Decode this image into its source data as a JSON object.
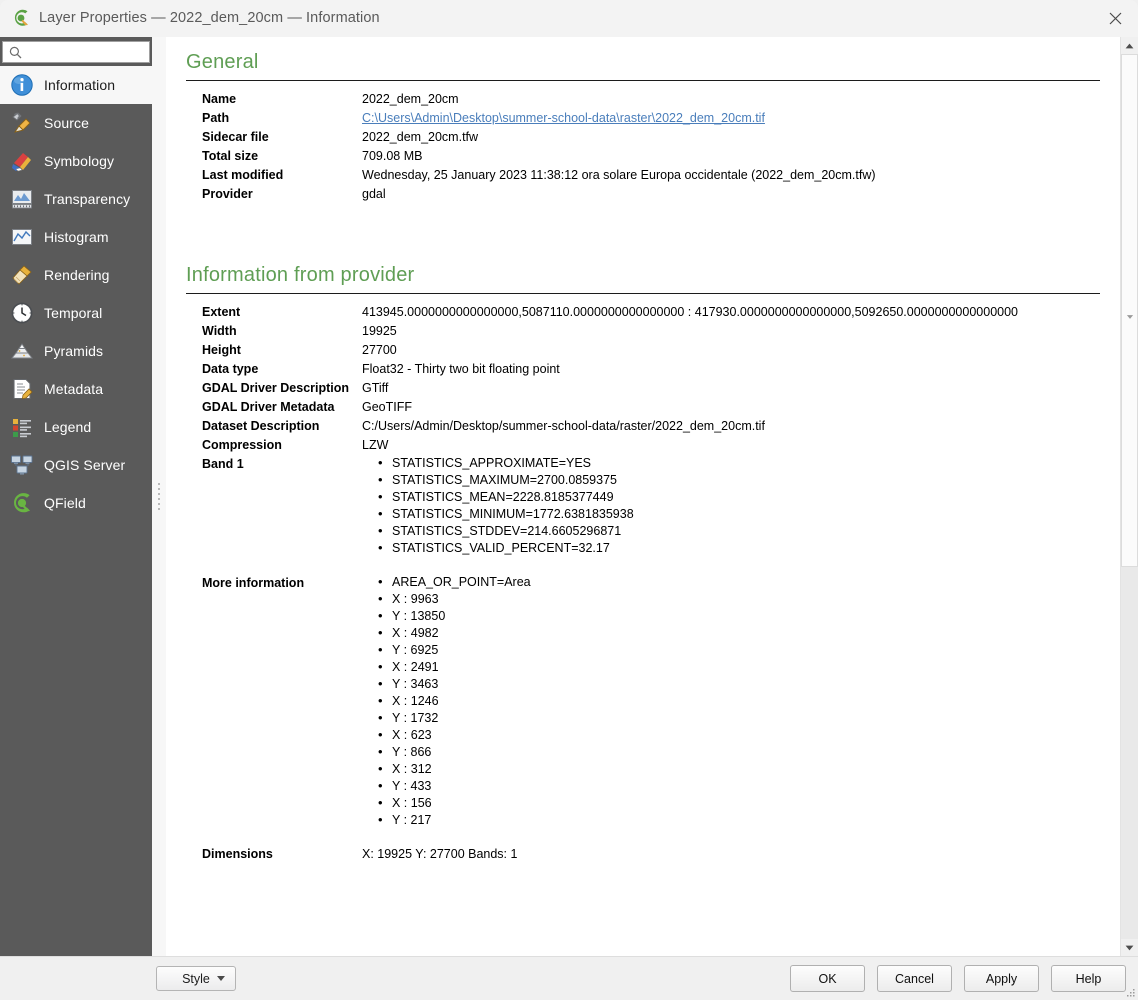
{
  "window": {
    "title": "Layer Properties — 2022_dem_20cm — Information",
    "logo_icon": "qgis-logo-icon",
    "close_icon": "close-icon"
  },
  "sidebar": {
    "search": {
      "value": "",
      "placeholder": "",
      "icon": "search-icon"
    },
    "items": [
      {
        "label": "Information",
        "icon": "information-icon",
        "selected": true
      },
      {
        "label": "Source",
        "icon": "source-icon",
        "selected": false
      },
      {
        "label": "Symbology",
        "icon": "symbology-icon",
        "selected": false
      },
      {
        "label": "Transparency",
        "icon": "transparency-icon",
        "selected": false
      },
      {
        "label": "Histogram",
        "icon": "histogram-icon",
        "selected": false
      },
      {
        "label": "Rendering",
        "icon": "rendering-icon",
        "selected": false
      },
      {
        "label": "Temporal",
        "icon": "temporal-clock-icon",
        "selected": false
      },
      {
        "label": "Pyramids",
        "icon": "pyramids-icon",
        "selected": false
      },
      {
        "label": "Metadata",
        "icon": "metadata-icon",
        "selected": false
      },
      {
        "label": "Legend",
        "icon": "legend-icon",
        "selected": false
      },
      {
        "label": "QGIS Server",
        "icon": "qgis-server-icon",
        "selected": false
      },
      {
        "label": "QField",
        "icon": "qfield-icon",
        "selected": false
      }
    ]
  },
  "content": {
    "general": {
      "title": "General",
      "rows": [
        {
          "key": "Name",
          "value": "2022_dem_20cm",
          "link": false
        },
        {
          "key": "Path",
          "value": "C:\\Users\\Admin\\Desktop\\summer-school-data\\raster\\2022_dem_20cm.tif",
          "link": true
        },
        {
          "key": "Sidecar file",
          "value": "2022_dem_20cm.tfw",
          "link": false
        },
        {
          "key": "Total size",
          "value": "709.08 MB",
          "link": false
        },
        {
          "key": "Last modified",
          "value": "Wednesday, 25 January 2023 11:38:12 ora solare Europa occidentale (2022_dem_20cm.tfw)",
          "link": false
        },
        {
          "key": "Provider",
          "value": "gdal",
          "link": false
        }
      ]
    },
    "provider": {
      "title": "Information from provider",
      "rows": [
        {
          "key": "Extent",
          "value": "413945.0000000000000000,5087110.0000000000000000 : 417930.0000000000000000,5092650.0000000000000000"
        },
        {
          "key": "Width",
          "value": "19925"
        },
        {
          "key": "Height",
          "value": "27700"
        },
        {
          "key": "Data type",
          "value": "Float32 - Thirty two bit floating point"
        },
        {
          "key": "GDAL Driver Description",
          "value": "GTiff"
        },
        {
          "key": "GDAL Driver Metadata",
          "value": "GeoTIFF"
        },
        {
          "key": "Dataset Description",
          "value": "C:/Users/Admin/Desktop/summer-school-data/raster/2022_dem_20cm.tif"
        },
        {
          "key": "Compression",
          "value": "LZW"
        }
      ],
      "band1": {
        "key": "Band 1",
        "stats": [
          "STATISTICS_APPROXIMATE=YES",
          "STATISTICS_MAXIMUM=2700.0859375",
          "STATISTICS_MEAN=2228.8185377449",
          "STATISTICS_MINIMUM=1772.6381835938",
          "STATISTICS_STDDEV=214.6605296871",
          "STATISTICS_VALID_PERCENT=32.17"
        ]
      },
      "more_information": {
        "key": "More information",
        "area_or_point": "AREA_OR_POINT=Area",
        "overviews": [
          {
            "x": "X : 9963",
            "y": "Y : 13850"
          },
          {
            "x": "X : 4982",
            "y": "Y : 6925"
          },
          {
            "x": "X : 2491",
            "y": "Y : 3463"
          },
          {
            "x": "X : 1246",
            "y": "Y : 1732"
          },
          {
            "x": "X : 623",
            "y": "Y : 866"
          },
          {
            "x": "X : 312",
            "y": "Y : 433"
          },
          {
            "x": "X : 156",
            "y": "Y : 217"
          }
        ]
      },
      "dimensions": {
        "key": "Dimensions",
        "value": "X: 19925 Y: 27700 Bands: 1"
      }
    }
  },
  "footer": {
    "style_label": "Style",
    "buttons": [
      {
        "label": "OK",
        "name": "ok-button"
      },
      {
        "label": "Cancel",
        "name": "cancel-button"
      },
      {
        "label": "Apply",
        "name": "apply-button"
      },
      {
        "label": "Help",
        "name": "help-button"
      }
    ]
  },
  "colors": {
    "section_title": "#5f9e54",
    "sidebar_bg": "#5a5a5a",
    "link": "#4a7ebb"
  }
}
